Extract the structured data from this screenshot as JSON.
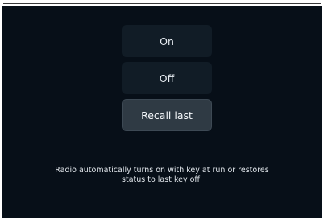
{
  "radio_power_setting": {
    "options": [
      {
        "label": "On",
        "selected": false
      },
      {
        "label": "Off",
        "selected": false
      },
      {
        "label": "Recall last",
        "selected": true
      }
    ],
    "description_line1": "Radio automatically turns on with key at run or restores",
    "description_line2": "status to last key off."
  }
}
